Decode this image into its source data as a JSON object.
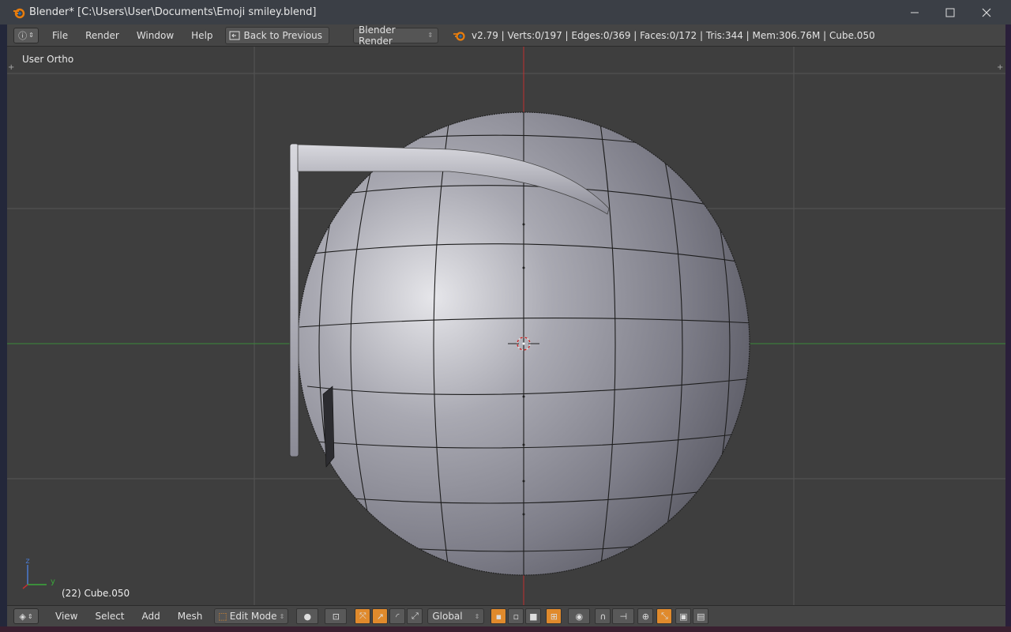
{
  "window": {
    "title": "Blender* [C:\\Users\\User\\Documents\\Emoji smiley.blend]",
    "minimize_icon": "minimize-icon",
    "maximize_icon": "maximize-icon",
    "close_icon": "close-icon"
  },
  "infobar": {
    "menus": [
      "File",
      "Render",
      "Window",
      "Help"
    ],
    "back_label": "Back to Previous",
    "render_engine": "Blender Render",
    "stats": "v2.79 | Verts:0/197 | Edges:0/369 | Faces:0/172 | Tris:344 | Mem:306.76M | Cube.050"
  },
  "viewport": {
    "view_label": "User Ortho",
    "object_info": "(22) Cube.050",
    "axis_z": "z",
    "axis_y": "y"
  },
  "bottombar": {
    "menus": [
      "View",
      "Select",
      "Add",
      "Mesh"
    ],
    "mode": "Edit Mode",
    "orientation": "Global"
  },
  "colors": {
    "accent_orange": "#e08a2c",
    "x_axis_red": "#c03030",
    "y_axis_green": "#3a8a3a",
    "grid": "#555555"
  }
}
